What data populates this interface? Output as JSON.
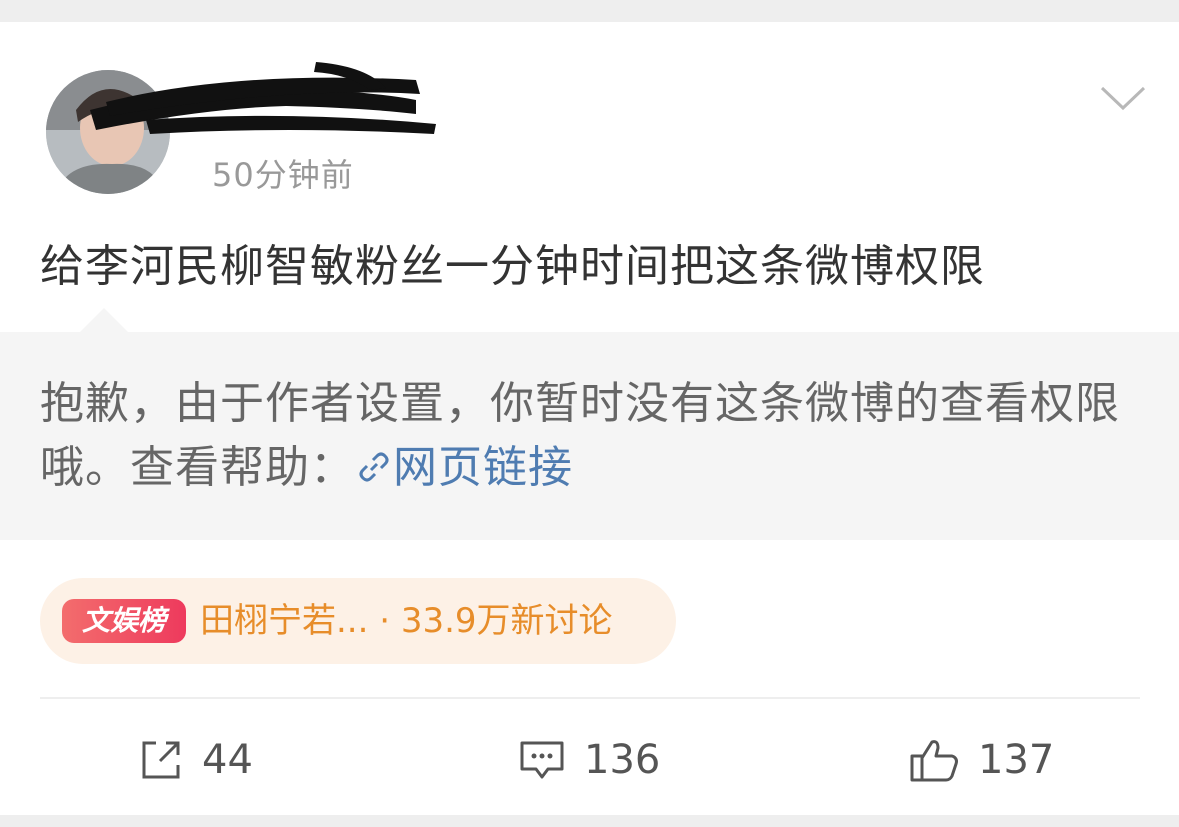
{
  "post": {
    "time": "50分钟前",
    "text": "给李河民柳智敏粉丝一分钟时间把这条微博权限"
  },
  "notice": {
    "text": "抱歉，由于作者设置，你暂时没有这条微博的查看权限哦。查看帮助：",
    "link_label": "网页链接"
  },
  "hot_topic": {
    "badge": "文娱榜",
    "text": "田栩宁若... · 33.9万新讨论"
  },
  "actions": {
    "repost_count": "44",
    "comment_count": "136",
    "like_count": "137"
  },
  "colors": {
    "link": "#4f7cb1",
    "hot_text": "#e78d2a",
    "badge": "#ee3a5d"
  },
  "icons": [
    "chevron-down-icon",
    "link-icon",
    "repost-icon",
    "comment-icon",
    "like-icon"
  ]
}
